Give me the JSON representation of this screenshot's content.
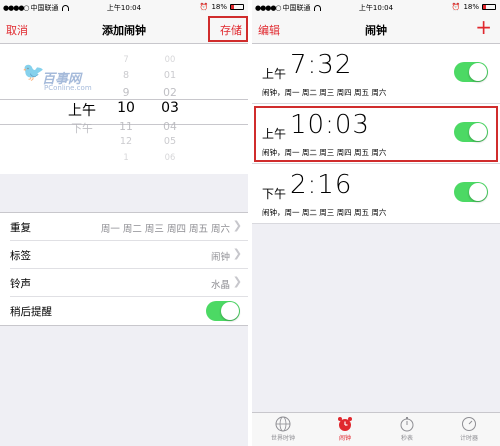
{
  "status": {
    "carrier": "中国联通",
    "time": "上午10:04",
    "battery": "18%"
  },
  "add_alarm": {
    "nav": {
      "cancel": "取消",
      "title": "添加闹钟",
      "save": "存储"
    },
    "watermark": {
      "text": "百事网",
      "sub": "PConline.com"
    },
    "picker": {
      "ampm": [
        "上午",
        "下午"
      ],
      "hours": [
        "7",
        "8",
        "9",
        "10",
        "11",
        "12",
        "1"
      ],
      "minutes": [
        "00",
        "01",
        "02",
        "03",
        "04",
        "05",
        "06"
      ],
      "selected": {
        "ampm": "上午",
        "hour": "10",
        "minute": "03"
      }
    },
    "settings": [
      {
        "label": "重复",
        "value": "周一 周二 周三 周四 周五 周六"
      },
      {
        "label": "标签",
        "value": "闹钟"
      },
      {
        "label": "铃声",
        "value": "水晶"
      },
      {
        "label": "稍后提醒",
        "toggle": true
      }
    ]
  },
  "alarms": {
    "nav": {
      "edit": "编辑",
      "title": "闹钟",
      "add": "+"
    },
    "items": [
      {
        "ampm": "上午",
        "time": "7:32",
        "sub": "闹钟，周一 周二 周三 周四 周五 周六",
        "on": true
      },
      {
        "ampm": "上午",
        "time": "10:03",
        "sub": "闹钟，周一 周二 周三 周四 周五 周六",
        "on": true
      },
      {
        "ampm": "下午",
        "time": "2:16",
        "sub": "闹钟，周一 周二 周三 周四 周五 周六",
        "on": true
      }
    ],
    "tabs": [
      {
        "label": "世界时钟",
        "icon": "globe-icon",
        "active": false
      },
      {
        "label": "闹钟",
        "icon": "alarm-clock-icon",
        "active": true
      },
      {
        "label": "秒表",
        "icon": "stopwatch-icon",
        "active": false
      },
      {
        "label": "计时器",
        "icon": "timer-icon",
        "active": false
      }
    ]
  },
  "colors": {
    "accent": "#e0282e",
    "toggle_on": "#4cd964",
    "highlight": "#d02c2c"
  }
}
